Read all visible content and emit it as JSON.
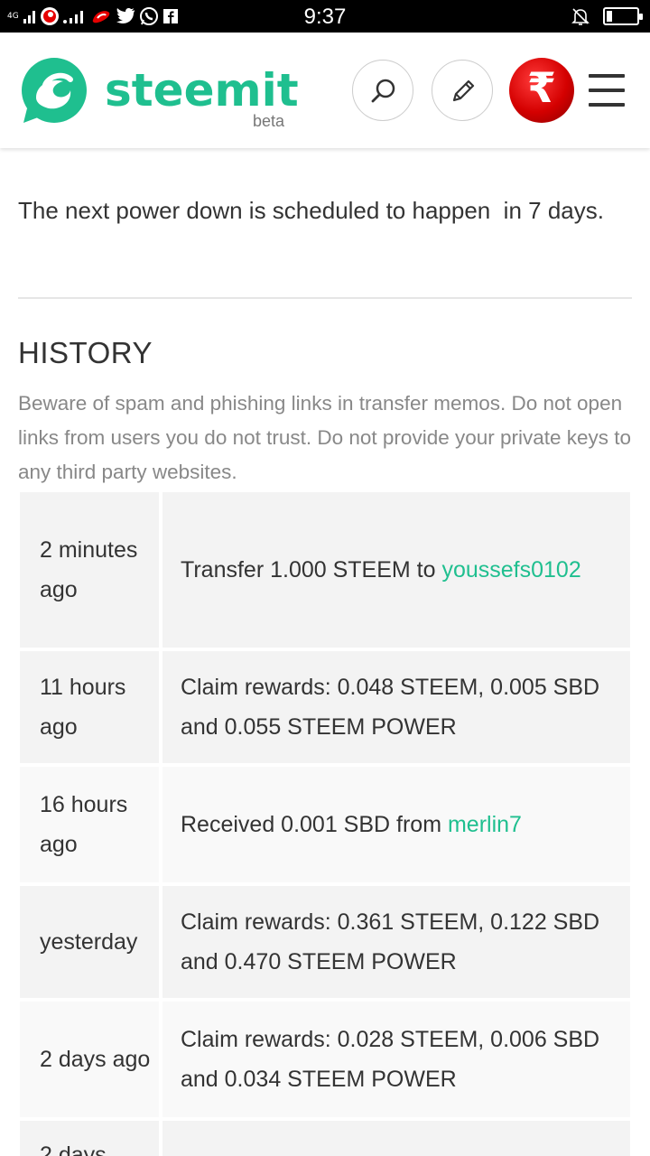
{
  "status_bar": {
    "network_label": "4G",
    "time": "9:37",
    "battery_level": 0.2
  },
  "header": {
    "logo_text": "steemit",
    "logo_subtitle": "beta",
    "brand_color": "#1fbf8f",
    "avatar_symbol": "₹",
    "icons": {
      "search": "search-icon",
      "edit": "pencil-icon",
      "menu": "hamburger-menu-icon"
    }
  },
  "content": {
    "power_down_notice": "The next power down is scheduled to happen  in 7 days.",
    "history_title": "HISTORY",
    "history_warning": "Beware of spam and phishing links in transfer memos. Do not open links from users you do not trust. Do not provide your private keys to any third party websites."
  },
  "history": [
    {
      "time": "2 minutes ago",
      "text": "Transfer 1.000 STEEM to ",
      "link": "youssefs0102"
    },
    {
      "time": "11 hours ago",
      "text": "Claim rewards: 0.048 STEEM, 0.005 SBD and 0.055 STEEM POWER",
      "link": ""
    },
    {
      "time": "16 hours ago",
      "text": "Received 0.001 SBD from ",
      "link": "merlin7"
    },
    {
      "time": "yesterday",
      "text": "Claim rewards: 0.361 STEEM, 0.122 SBD and 0.470 STEEM POWER",
      "link": ""
    },
    {
      "time": "2 days ago",
      "text": "Claim rewards: 0.028 STEEM, 0.006 SBD and 0.034 STEEM POWER",
      "link": ""
    },
    {
      "time": "2 days",
      "text": "",
      "link": ""
    }
  ]
}
